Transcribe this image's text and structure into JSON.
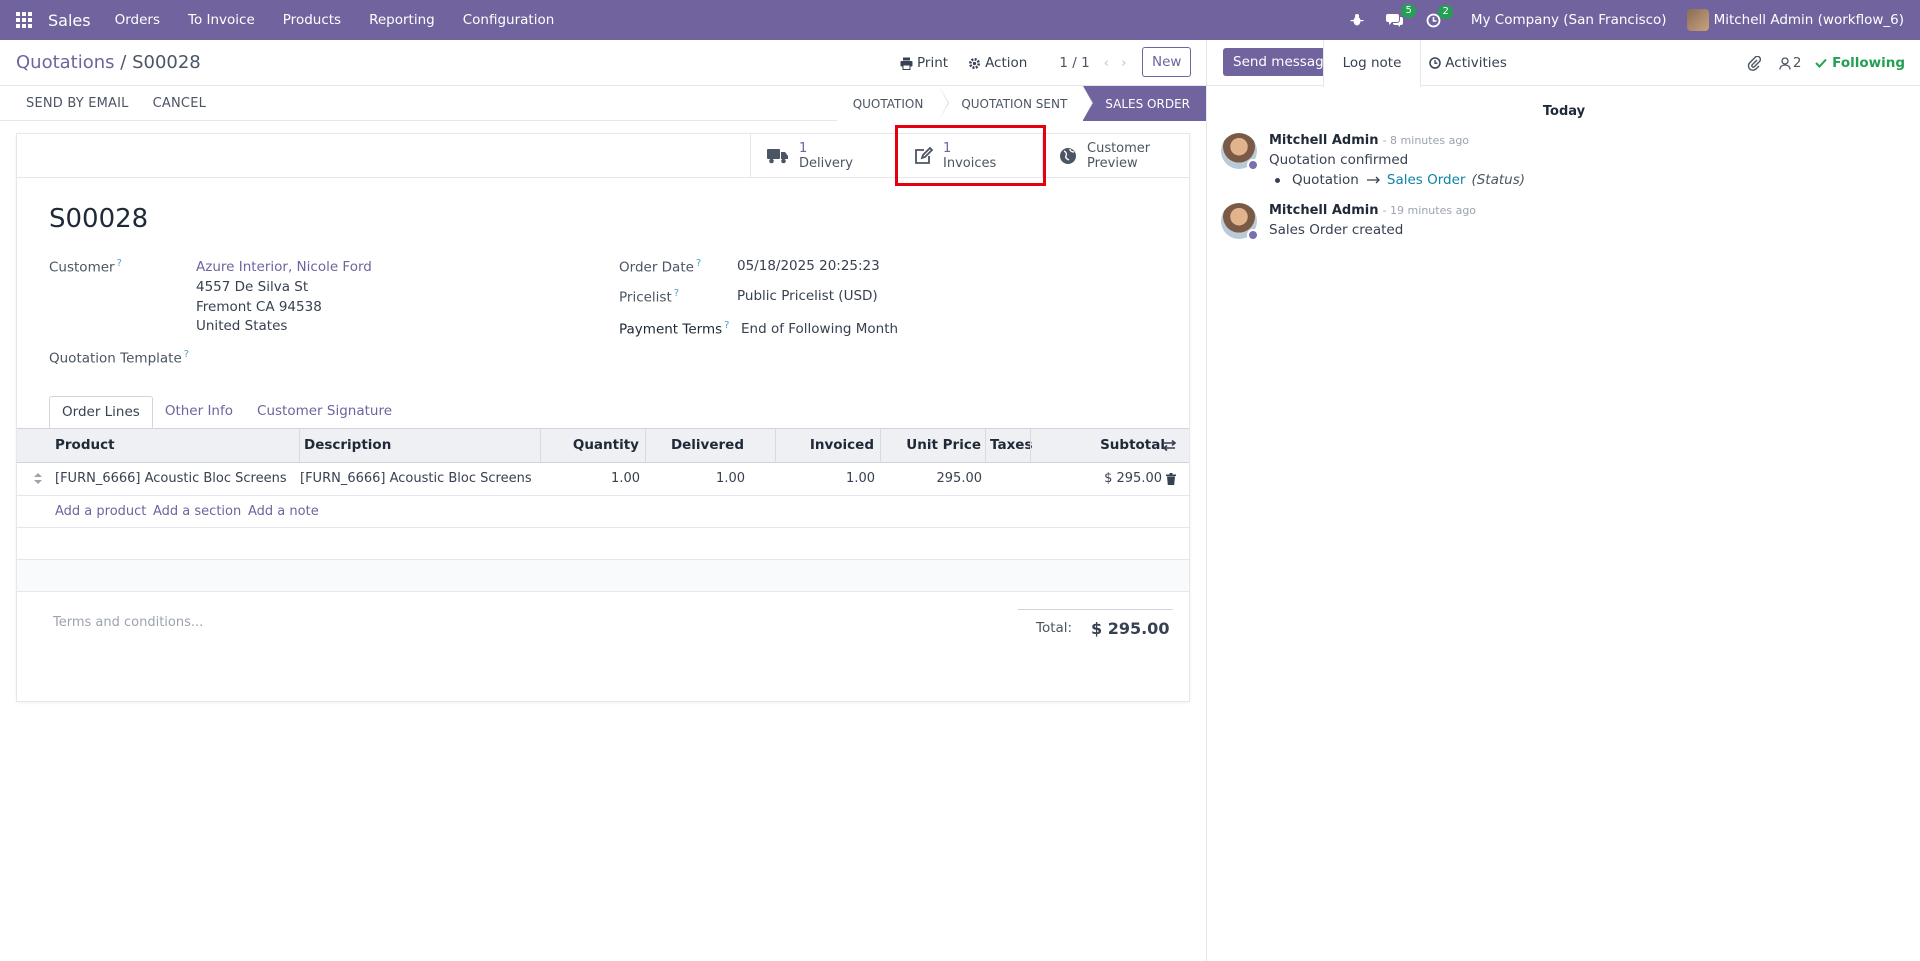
{
  "navbar": {
    "brand": "Sales",
    "menu": [
      "Orders",
      "To Invoice",
      "Products",
      "Reporting",
      "Configuration"
    ],
    "messages_count": "5",
    "activities_count": "2",
    "company": "My Company (San Francisco)",
    "user": "Mitchell Admin (workflow_6)"
  },
  "control_panel": {
    "breadcrumb_parent": "Quotations",
    "breadcrumb_sep": " / ",
    "breadcrumb_current": "S00028",
    "print": "Print",
    "action": "Action",
    "pager": "1 / 1",
    "new": "New"
  },
  "status_bar": {
    "buttons": [
      "SEND BY EMAIL",
      "CANCEL"
    ],
    "stages": [
      "QUOTATION",
      "QUOTATION SENT",
      "SALES ORDER"
    ],
    "active_stage": "SALES ORDER"
  },
  "smart_buttons": {
    "delivery_count": "1",
    "delivery_label": "Delivery",
    "invoices_count": "1",
    "invoices_label": "Invoices",
    "preview_line1": "Customer",
    "preview_line2": "Preview"
  },
  "form": {
    "name": "S00028",
    "customer_label": "Customer",
    "customer_name": "Azure Interior, Nicole Ford",
    "address_line1": "4557 De Silva St",
    "address_line2": "Fremont CA 94538",
    "address_line3": "United States",
    "quotation_template_label": "Quotation Template",
    "order_date_label": "Order Date",
    "order_date": "05/18/2025 20:25:23",
    "pricelist_label": "Pricelist",
    "pricelist": "Public Pricelist (USD)",
    "payment_terms_label": "Payment Terms",
    "payment_terms": "End of Following Month"
  },
  "tabs": [
    "Order Lines",
    "Other Info",
    "Customer Signature"
  ],
  "order_lines": {
    "columns": [
      "Product",
      "Description",
      "Quantity",
      "Delivered",
      "Invoiced",
      "Unit Price",
      "Taxes",
      "Subtotal"
    ],
    "rows": [
      {
        "product": "[FURN_6666] Acoustic Bloc Screens",
        "description": "[FURN_6666] Acoustic Bloc Screens",
        "quantity": "1.00",
        "delivered": "1.00",
        "invoiced": "1.00",
        "unit_price": "295.00",
        "taxes": "",
        "subtotal": "$ 295.00"
      }
    ],
    "add_product": "Add a product",
    "add_section": "Add a section",
    "add_note": "Add a note"
  },
  "totals": {
    "terms_placeholder": "Terms and conditions...",
    "total_label": "Total:",
    "total_value": "$ 295.00"
  },
  "chatter": {
    "send_message": "Send message",
    "log_note": "Log note",
    "activities": "Activities",
    "followers_count": "2",
    "following": "Following",
    "day": "Today",
    "messages": [
      {
        "author": "Mitchell Admin",
        "time": "- 8 minutes ago",
        "body": "Quotation confirmed",
        "change_from": "Quotation",
        "change_to": "Sales Order",
        "change_field": "(Status)"
      },
      {
        "author": "Mitchell Admin",
        "time": "- 19 minutes ago",
        "body": "Sales Order created"
      }
    ]
  },
  "colors": {
    "brand": "#71639e",
    "highlight": "#e3000f",
    "following": "#23a052"
  }
}
